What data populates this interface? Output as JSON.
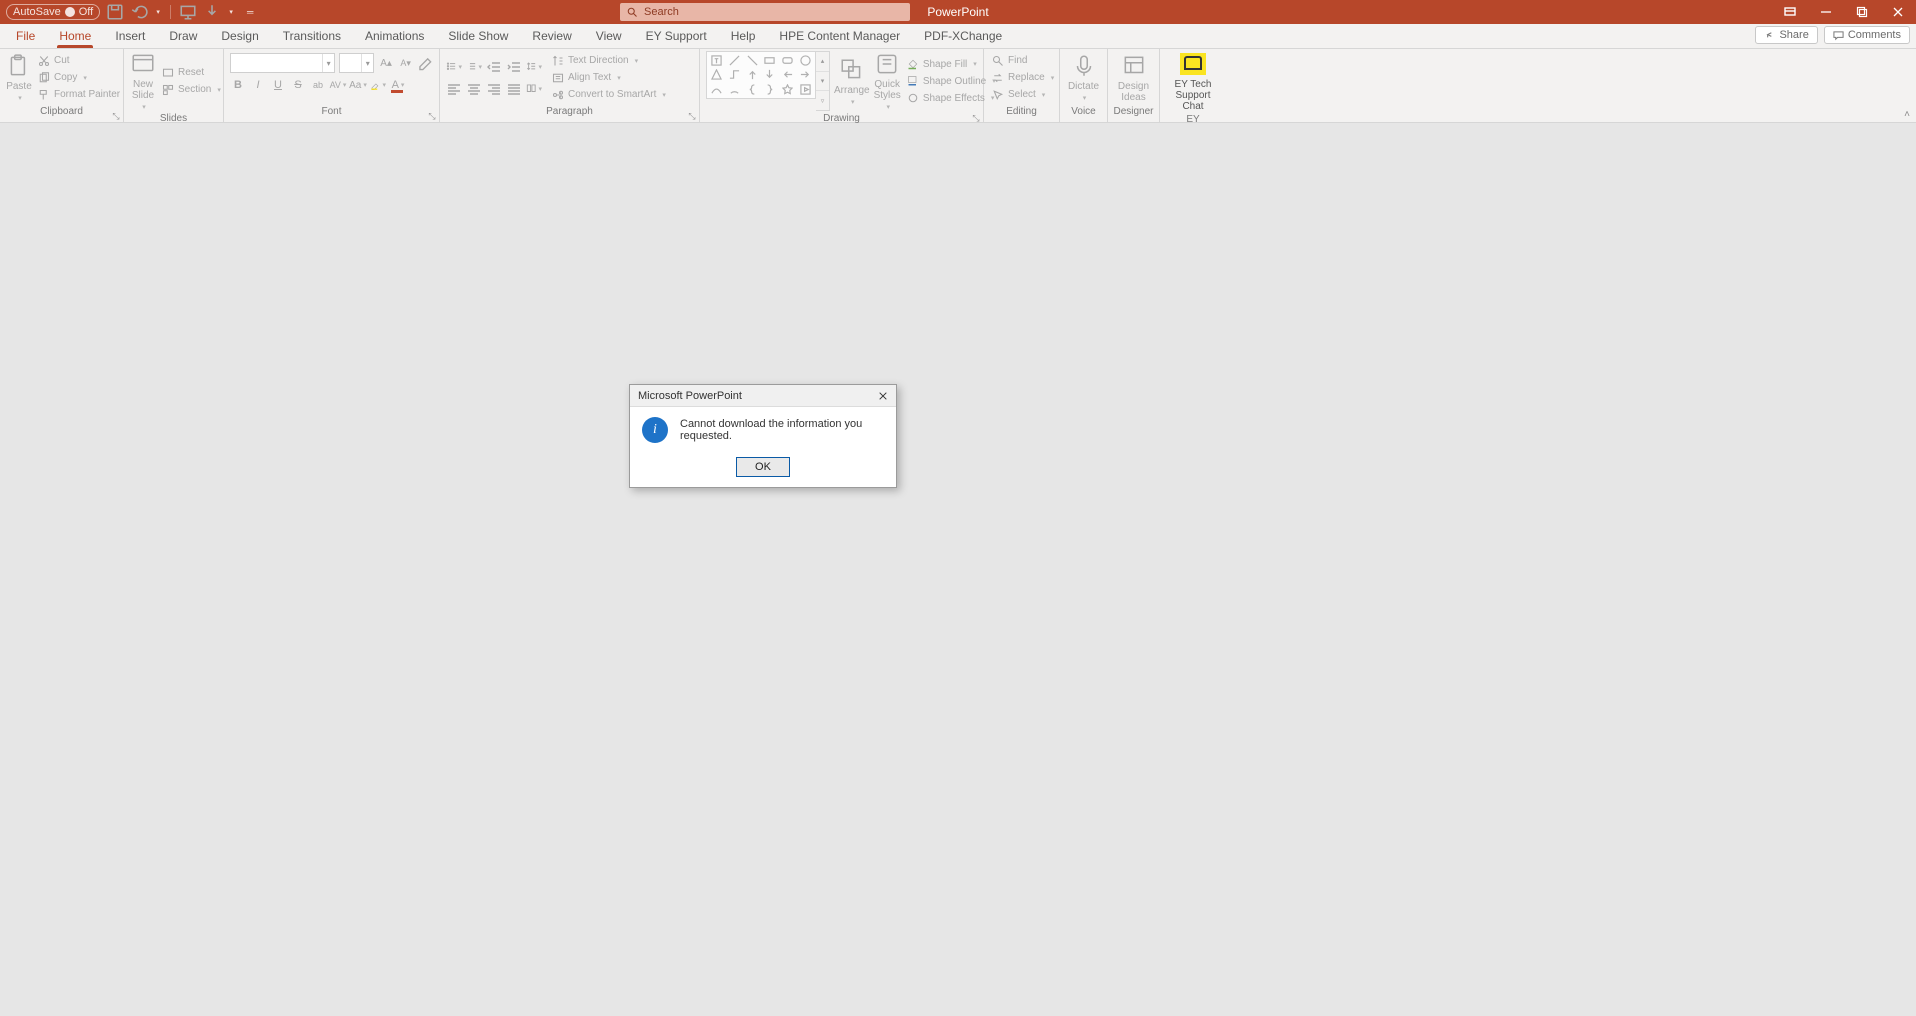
{
  "titlebar": {
    "autosave_label": "AutoSave",
    "autosave_state": "Off",
    "app_title": "PowerPoint",
    "search_placeholder": "Search"
  },
  "tabs": {
    "file": "File",
    "home": "Home",
    "insert": "Insert",
    "draw": "Draw",
    "design": "Design",
    "transitions": "Transitions",
    "animations": "Animations",
    "slideshow": "Slide Show",
    "review": "Review",
    "view": "View",
    "ey_support": "EY Support",
    "help": "Help",
    "hpe": "HPE Content Manager",
    "pdf": "PDF-XChange",
    "share": "Share",
    "comments": "Comments"
  },
  "ribbon": {
    "clipboard": {
      "label": "Clipboard",
      "paste": "Paste",
      "cut": "Cut",
      "copy": "Copy",
      "format_painter": "Format Painter"
    },
    "slides": {
      "label": "Slides",
      "new_slide": "New\nSlide",
      "reset": "Reset",
      "section": "Section"
    },
    "font": {
      "label": "Font"
    },
    "paragraph": {
      "label": "Paragraph",
      "text_direction": "Text Direction",
      "align_text": "Align Text",
      "smartart": "Convert to SmartArt"
    },
    "drawing": {
      "label": "Drawing",
      "arrange": "Arrange",
      "quick_styles": "Quick\nStyles",
      "shape_fill": "Shape Fill",
      "shape_outline": "Shape Outline",
      "shape_effects": "Shape Effects"
    },
    "editing": {
      "label": "Editing",
      "find": "Find",
      "replace": "Replace",
      "select": "Select"
    },
    "voice": {
      "label": "Voice",
      "dictate": "Dictate"
    },
    "designer": {
      "label": "Designer",
      "design_ideas": "Design\nIdeas"
    },
    "ey": {
      "label": "EY",
      "chat": "EY Tech\nSupport Chat"
    }
  },
  "dialog": {
    "title": "Microsoft PowerPoint",
    "message": "Cannot download the information you requested.",
    "ok": "OK"
  }
}
